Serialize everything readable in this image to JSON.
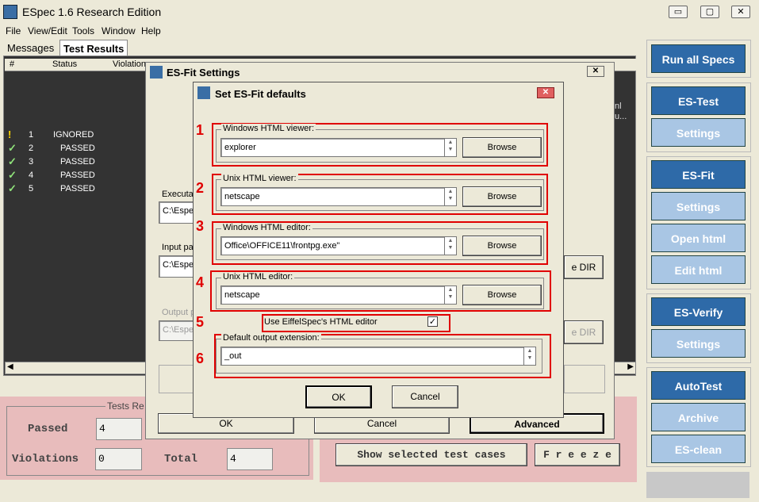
{
  "window": {
    "title": "ESpec 1.6 Research Edition",
    "min": "▭",
    "max": "▢",
    "close": "✕"
  },
  "menu": [
    "File",
    "View/Edit",
    "Tools",
    "Window",
    "Help"
  ],
  "tabs": [
    "Messages",
    "Test Results"
  ],
  "table": {
    "headers": [
      "#",
      "Status",
      "Violation"
    ],
    "rows": [
      {
        "num": "1",
        "status": "IGNORED",
        "icon": "!"
      },
      {
        "num": "2",
        "status": "PASSED",
        "icon": "✓"
      },
      {
        "num": "3",
        "status": "PASSED",
        "icon": "✓"
      },
      {
        "num": "4",
        "status": "PASSED",
        "icon": "✓"
      },
      {
        "num": "5",
        "status": "PASSED",
        "icon": "✓"
      }
    ],
    "overflow": "nl\nu..."
  },
  "tests_results": {
    "legend": "Tests Re",
    "passed_label": "Passed",
    "passed_value": "4",
    "violations_label": "Violations",
    "violations_value": "0",
    "total_label": "Total",
    "total_value": "4"
  },
  "bottom_buttons": {
    "show_selected": "Show selected test cases",
    "freeze": "F r e e z e"
  },
  "right_panel": {
    "run_all": "Run all Specs",
    "es_test": "ES-Test",
    "es_test_settings": "Settings",
    "es_fit": "ES-Fit",
    "es_fit_settings": "Settings",
    "open_html": "Open html",
    "edit_html": "Edit html",
    "es_verify": "ES-Verify",
    "es_verify_settings": "Settings",
    "autotest": "AutoTest",
    "archive": "Archive",
    "es_clean": "ES-clean"
  },
  "esfit_settings": {
    "title": "ES-Fit Settings",
    "executable_label": "Executa",
    "executable_value": "C:\\Espe",
    "input_label": "Input pa",
    "input_value": "C:\\Espe",
    "output_label": "Output p",
    "output_value": "C:\\Espe",
    "dir_btn": "e DIR",
    "dir_btn2": "e DIR",
    "ok": "OK",
    "cancel": "Cancel",
    "advanced": "Advanced"
  },
  "defaults_dialog": {
    "title": "Set ES-Fit defaults",
    "win_viewer_label": "Windows HTML viewer:",
    "win_viewer_value": "explorer",
    "unix_viewer_label": "Unix HTML viewer:",
    "unix_viewer_value": "netscape",
    "win_editor_label": "Windows HTML editor:",
    "win_editor_value": "Office\\OFFICE11\\frontpg.exe\"",
    "unix_editor_label": "Unix HTML editor:",
    "unix_editor_value": "netscape",
    "use_editor_label": "Use EiffelSpec's HTML editor",
    "use_editor_check": "✓",
    "ext_label": "Default output extension:",
    "ext_value": "_out",
    "browse": "Browse",
    "ok": "OK",
    "cancel": "Cancel",
    "annotations": [
      "1",
      "2",
      "3",
      "4",
      "5",
      "6"
    ]
  }
}
